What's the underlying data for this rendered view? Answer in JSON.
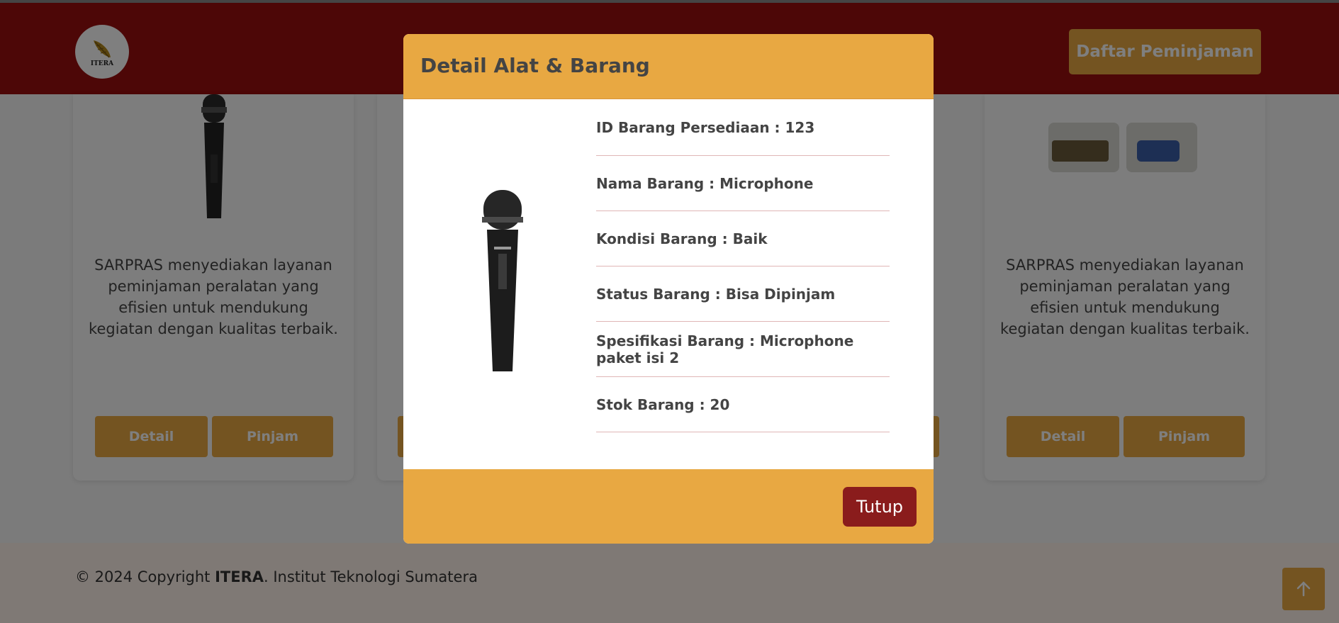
{
  "navbar": {
    "logo_text": "ITERA",
    "daftar_button": "Daftar Peminjaman"
  },
  "cards": [
    {
      "description": "SARPRAS menyediakan layanan peminjaman peralatan yang efisien untuk mendukung kegiatan dengan kualitas terbaik.",
      "detail_label": "Detail",
      "pinjam_label": "Pinjam"
    },
    {
      "description": "SARPRAS menyediakan layanan peminjaman peralatan yang efisien untuk mendukung kegiatan dengan kualitas terbaik.",
      "detail_label": "Detail",
      "pinjam_label": "Pinjam"
    }
  ],
  "footer": {
    "copyright_prefix": "© 2024 Copyright ",
    "brand": "ITERA",
    "copyright_suffix": ". Institut Teknologi Sumatera"
  },
  "modal": {
    "title": "Detail Alat & Barang",
    "fields": [
      "ID Barang Persediaan : 123",
      "Nama Barang : Microphone",
      "Kondisi Barang : Baik",
      "Status Barang : Bisa Dipinjam",
      "Spesifikasi Barang : Microphone paket isi 2",
      "Stok Barang : 20"
    ],
    "close_label": "Tutup"
  },
  "colors": {
    "navbar": "#9b0e0e",
    "accent": "#e8a842",
    "close_button": "#8a1c1c"
  },
  "icons": {
    "scroll_top": "arrow-up-icon",
    "logo": "leaf-logo-icon"
  }
}
